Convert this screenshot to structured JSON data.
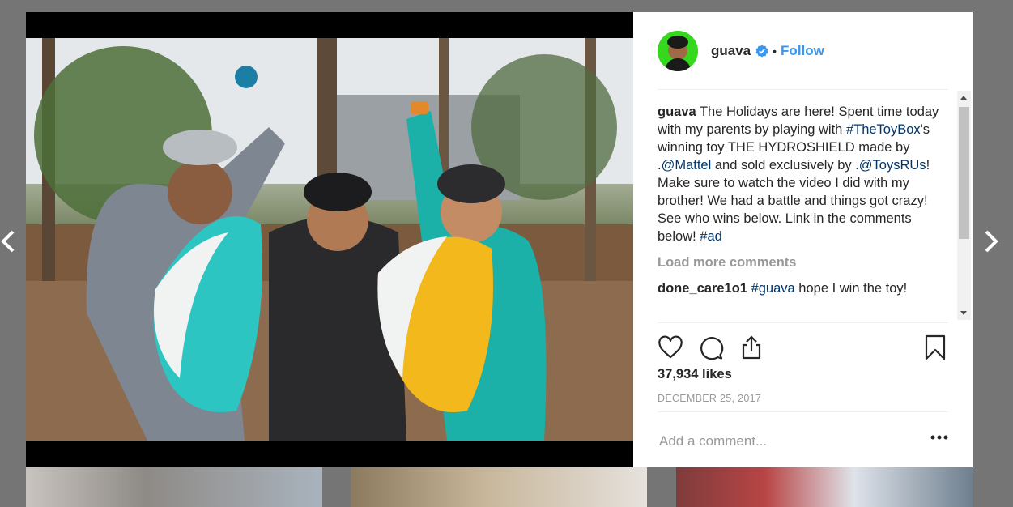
{
  "post": {
    "username": "guava",
    "separator": "•",
    "follow_label": "Follow",
    "caption": {
      "user": "guava",
      "text_parts": [
        {
          "t": " The Holidays are here! Spent time today with my parents by playing with ",
          "tag": false
        },
        {
          "t": "#TheToyBox",
          "tag": true
        },
        {
          "t": "'s winning toy THE HYDROSHIELD made by .",
          "tag": false
        },
        {
          "t": "@Mattel",
          "tag": true
        },
        {
          "t": " and sold exclusively by .",
          "tag": false
        },
        {
          "t": "@ToysRUs",
          "tag": true
        },
        {
          "t": "! Make sure to watch the video I did with my brother! We had a battle and things got crazy! See who wins below. Link in the comments below! ",
          "tag": false
        },
        {
          "t": "#ad",
          "tag": true
        }
      ]
    },
    "load_more_label": "Load more comments",
    "first_comment": {
      "user": "done_care1o1",
      "tag": "#guava",
      "text": " hope I win the toy!"
    },
    "likes": "37,934 likes",
    "date": "DECEMBER 25, 2017",
    "add_comment_placeholder": "Add a comment..."
  },
  "icons": [
    "chevron-left-icon",
    "chevron-right-icon",
    "verified-icon",
    "heart-icon",
    "comment-icon",
    "share-icon",
    "bookmark-icon",
    "more-icon"
  ],
  "colors": {
    "accent": "#3897f0",
    "tag": "#003569",
    "avatar_ring": "#35d81d"
  }
}
